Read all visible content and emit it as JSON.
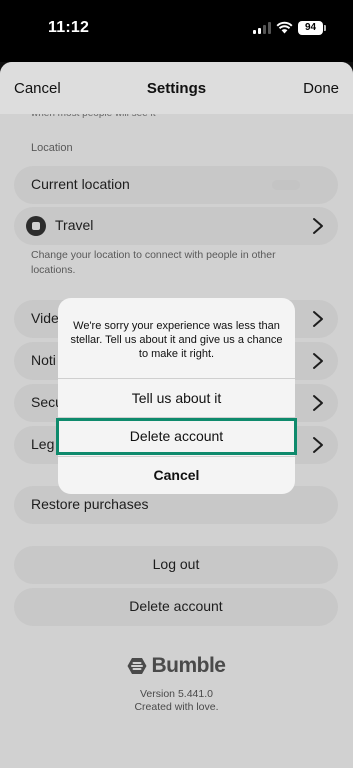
{
  "status_bar": {
    "time": "11:12",
    "battery": "94",
    "icons": [
      "cellular-signal-icon",
      "wifi-icon",
      "battery-icon"
    ]
  },
  "header": {
    "cancel": "Cancel",
    "title": "Settings",
    "done": "Done"
  },
  "settings": {
    "cut_text": "when most people will see it",
    "location_section": "Location",
    "current_location": "Current location",
    "travel": "Travel",
    "travel_note": "Change your location to connect with people in other locations.",
    "rows_behind_alert": [
      {
        "label": "Vide"
      },
      {
        "label": "Noti"
      },
      {
        "label": "Secu"
      },
      {
        "label": "Leg"
      }
    ],
    "restore_purchases": "Restore purchases",
    "log_out": "Log out",
    "delete_account": "Delete account"
  },
  "footer": {
    "brand": "Bumble",
    "version": "Version 5.441.0",
    "tagline": "Created with love."
  },
  "alert": {
    "message": "We're sorry your experience was less than stellar. Tell us about it and give us a chance to make it right.",
    "tell_us": "Tell us about it",
    "delete_account": "Delete account",
    "cancel": "Cancel"
  },
  "colors": {
    "highlight": "#0e8a6c",
    "sheet_bg": "#dddddd",
    "row_bg": "#d3d3d3"
  }
}
